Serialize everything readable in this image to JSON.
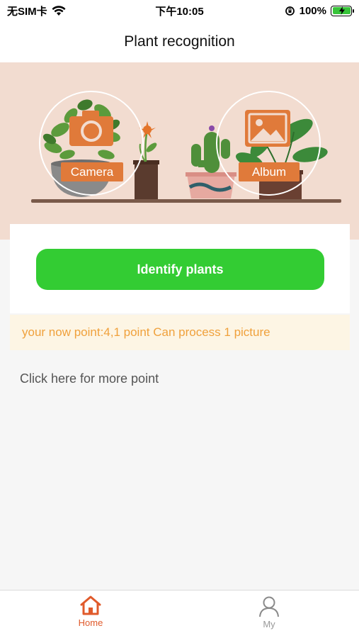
{
  "status_bar": {
    "carrier": "无SIM卡",
    "time": "下午10:05",
    "battery": "100%",
    "icons": [
      "wifi-icon",
      "orientation-lock-icon",
      "battery-charging-icon"
    ]
  },
  "header": {
    "title": "Plant recognition"
  },
  "banner": {
    "camera_label": "Camera",
    "album_label": "Album",
    "icons": [
      "camera-icon",
      "album-icon"
    ]
  },
  "actions": {
    "identify_label": "Identify plants"
  },
  "points": {
    "text": "your now point:4,1 point Can process 1 picture"
  },
  "more_link": {
    "text": "Click here for more point"
  },
  "tab_bar": {
    "tabs": [
      {
        "label": "Home",
        "icon": "home-icon",
        "active": true
      },
      {
        "label": "My",
        "icon": "user-icon",
        "active": false
      }
    ]
  },
  "colors": {
    "accent_green": "#33cc33",
    "banner_bg": "#f2dcd0",
    "label_orange": "#e07a3a",
    "points_text": "#f0a13c",
    "points_bg": "#fdf5e4",
    "tab_active": "#e05a2b",
    "tab_inactive": "#999999"
  }
}
